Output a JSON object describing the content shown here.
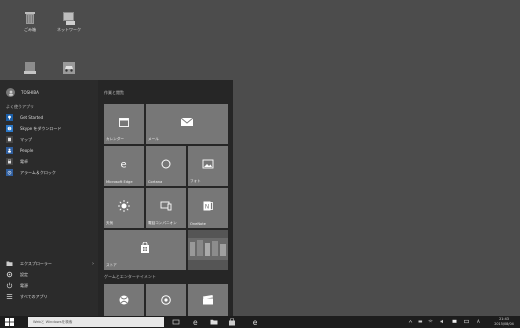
{
  "desktop": {
    "icons": [
      {
        "name": "recycle-bin",
        "label": "ごみ箱"
      },
      {
        "name": "shortcut",
        "label": "ネットワーク"
      },
      {
        "name": "drive",
        "label": ""
      },
      {
        "name": "car-app",
        "label": ""
      }
    ]
  },
  "start_menu": {
    "user_name": "TOSHIBA",
    "recent_header": "よく使うアプリ",
    "apps": [
      {
        "label": "Get Started",
        "icon": "lightbulb-icon",
        "color": "#1c5fa8"
      },
      {
        "label": "Skype をダウンロード",
        "icon": "skype-icon",
        "color": "#2b78c8"
      },
      {
        "label": "マップ",
        "icon": "map-icon",
        "color": "#444"
      },
      {
        "label": "People",
        "icon": "people-icon",
        "color": "#2f5e9e"
      },
      {
        "label": "電卓",
        "icon": "calculator-icon",
        "color": "#444"
      },
      {
        "label": "アラーム＆クロック",
        "icon": "alarm-icon",
        "color": "#2f5e9e"
      }
    ],
    "bottom": [
      {
        "label": "エクスプローラー",
        "icon": "folder-icon",
        "chevron": "›"
      },
      {
        "label": "設定",
        "icon": "gear-icon"
      },
      {
        "label": "電源",
        "icon": "power-icon"
      },
      {
        "label": "すべてのアプリ",
        "icon": "apps-list-icon"
      }
    ],
    "tiles_header": "作業と閲覧",
    "games_header": "ゲームとエンターテイメント",
    "tiles": [
      {
        "label": "カレンダー",
        "icon": "calendar-icon"
      },
      {
        "label": "メール",
        "icon": "mail-icon"
      },
      {
        "label": "Microsoft Edge",
        "icon": "edge-icon"
      },
      {
        "label": "Cortana",
        "icon": "cortana-icon"
      },
      {
        "label": "フォト",
        "icon": "photos-icon"
      },
      {
        "label": "天気",
        "icon": "weather-icon"
      },
      {
        "label": "電話コンパニオン",
        "icon": "phone-companion-icon"
      },
      {
        "label": "OneNote",
        "icon": "onenote-icon"
      },
      {
        "label": "ストア",
        "icon": "store-icon"
      },
      {
        "label": "",
        "icon": "news-image-tile"
      },
      {
        "label": "",
        "icon": "xbox-icon"
      },
      {
        "label": "",
        "icon": "groove-music-icon"
      },
      {
        "label": "",
        "icon": "movies-icon"
      }
    ]
  },
  "taskbar": {
    "search_placeholder": "Webと Windowsを検索",
    "clock_time": "21:43",
    "clock_date": "2015/08/04",
    "lang": "A"
  }
}
